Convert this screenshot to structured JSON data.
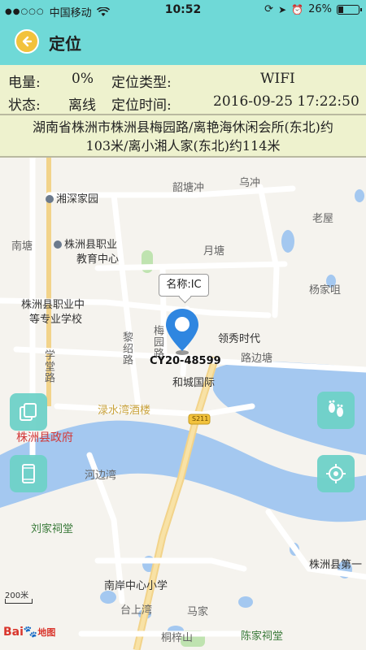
{
  "status_bar": {
    "signal_dots": "●●○○○",
    "carrier": "中国移动",
    "time": "10:52",
    "battery_text": "26%",
    "battery_level": 0.26
  },
  "header": {
    "title": "定位"
  },
  "info": {
    "battery_label": "电量:",
    "battery_value": "0%",
    "loc_type_label": "定位类型:",
    "loc_type_value": "WIFI",
    "state_label": "状态:",
    "state_value": "离线",
    "loc_time_label": "定位时间:",
    "loc_time_value": "2016-09-25 17:22:50"
  },
  "address": {
    "line1": "湖南省株洲市株洲县梅园路/离艳海休闲会所(东北)约",
    "line2": "103米/离小湘人家(东北)约114米"
  },
  "map": {
    "labels": {
      "xiangshen": "湘深家园",
      "shaotang": "韶塘冲",
      "wuchong": "乌冲",
      "laowu": "老屋",
      "nantang": "南塘",
      "zhiye": "株洲县职业",
      "zhiye2": "教育中心",
      "yuetang": "月塘",
      "yangjia": "杨家咀",
      "zhiye_mid": "株洲县职业中",
      "zhiye_mid2": "等专业学校",
      "lingxiu": "领秀时代",
      "lilu": "黎绍路",
      "meiyuan": "梅园路",
      "lubian": "路边塘",
      "xuetang": "学堂路",
      "hecheng": "和城国际",
      "lushui": "渌水湾酒楼",
      "s211": "S211",
      "gov": "株洲县政府",
      "hebian": "河边湾",
      "liujia": "刘家祠堂",
      "nanan": "南岸中心小学",
      "zhuzhou1": "株洲县第一",
      "taishang": "台上湾",
      "majia": "马家",
      "tongzi": "桐梓山",
      "chenjia": "陈家祠堂"
    },
    "callout": "名称:IC",
    "device_id": "CY20-48599",
    "scale": "200米",
    "logo_a": "Bai",
    "logo_b": "地图"
  },
  "colors": {
    "header": "#6fd9d7",
    "panel": "#eef2ce",
    "fab": "#6fd2c9",
    "pin": "#2f86e0",
    "water": "#a4c8f0"
  }
}
